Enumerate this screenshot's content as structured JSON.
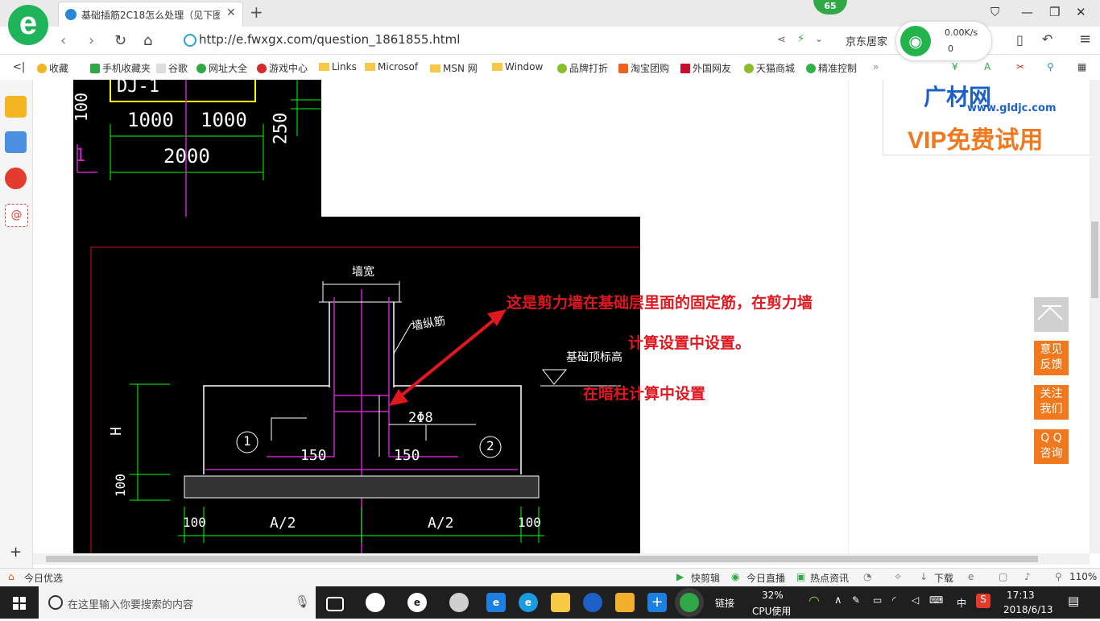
{
  "browser": {
    "tab_title": "基础插筋2C18怎么处理（见下图",
    "badge": "65",
    "url": "http://e.fwxgx.com/question_1861855.html",
    "search_hint": "京东居家",
    "net_speed": "0.00K/s",
    "net_conn": "0"
  },
  "bookmarks": [
    {
      "label": "收藏",
      "kind": "star"
    },
    {
      "label": "手机收藏夹",
      "kind": "phone"
    },
    {
      "label": "谷歌",
      "kind": "page"
    },
    {
      "label": "网址大全",
      "kind": "globe"
    },
    {
      "label": "游戏中心",
      "kind": "game"
    },
    {
      "label": "Links",
      "kind": "folder"
    },
    {
      "label": "Microsof",
      "kind": "folder"
    },
    {
      "label": "MSN 网",
      "kind": "folder"
    },
    {
      "label": "Window",
      "kind": "folder"
    },
    {
      "label": "品牌打折",
      "kind": "leaf"
    },
    {
      "label": "淘宝团购",
      "kind": "tao"
    },
    {
      "label": "外国网友",
      "kind": "red"
    },
    {
      "label": "天猫商城",
      "kind": "leaf"
    },
    {
      "label": "精准控制",
      "kind": "wechat"
    }
  ],
  "cad_top": {
    "label_dj": "DJ-1",
    "dim_left": "1000",
    "dim_right": "1000",
    "dim_total": "2000",
    "dim_side": "250",
    "dim_far_left": "100",
    "mark": "1"
  },
  "cad_bottom": {
    "wall_width": "墙宽",
    "wall_rebar": "墙纵筋",
    "foundation_top": "基础顶标高",
    "stirrup": "2Φ8",
    "anchor_left": "150",
    "anchor_right": "150",
    "height": "H",
    "pad": "100",
    "num_1": "1",
    "num_2": "2",
    "half_left": "A/2",
    "half_right": "A/2",
    "edge_left": "100",
    "edge_right": "100"
  },
  "notes": {
    "line1": "这是剪力墙在基础层里面的固定筋，在剪力墙",
    "line2": "计算设置中设置。",
    "line3": "在暗柱计算中设置"
  },
  "ad": {
    "brand": "广材网",
    "site": "www.gldjc.com",
    "vip": "VIP免费试用"
  },
  "float_buttons": {
    "feedback": "意见\n反馈",
    "follow": "关注\n我们",
    "qq": "Q Q\n咨询"
  },
  "statusbar": {
    "today": "今日优选",
    "kuaijian": "快剪辑",
    "live": "今日直播",
    "news": "热点资讯",
    "download": "下载",
    "zoom": "110%"
  },
  "taskbar": {
    "search_placeholder": "在这里输入你要搜索的内容",
    "link": "链接",
    "cpu_pct": "32%",
    "cpu_label": "CPU使用",
    "ime": "中",
    "time": "17:13",
    "date": "2018/6/13"
  }
}
